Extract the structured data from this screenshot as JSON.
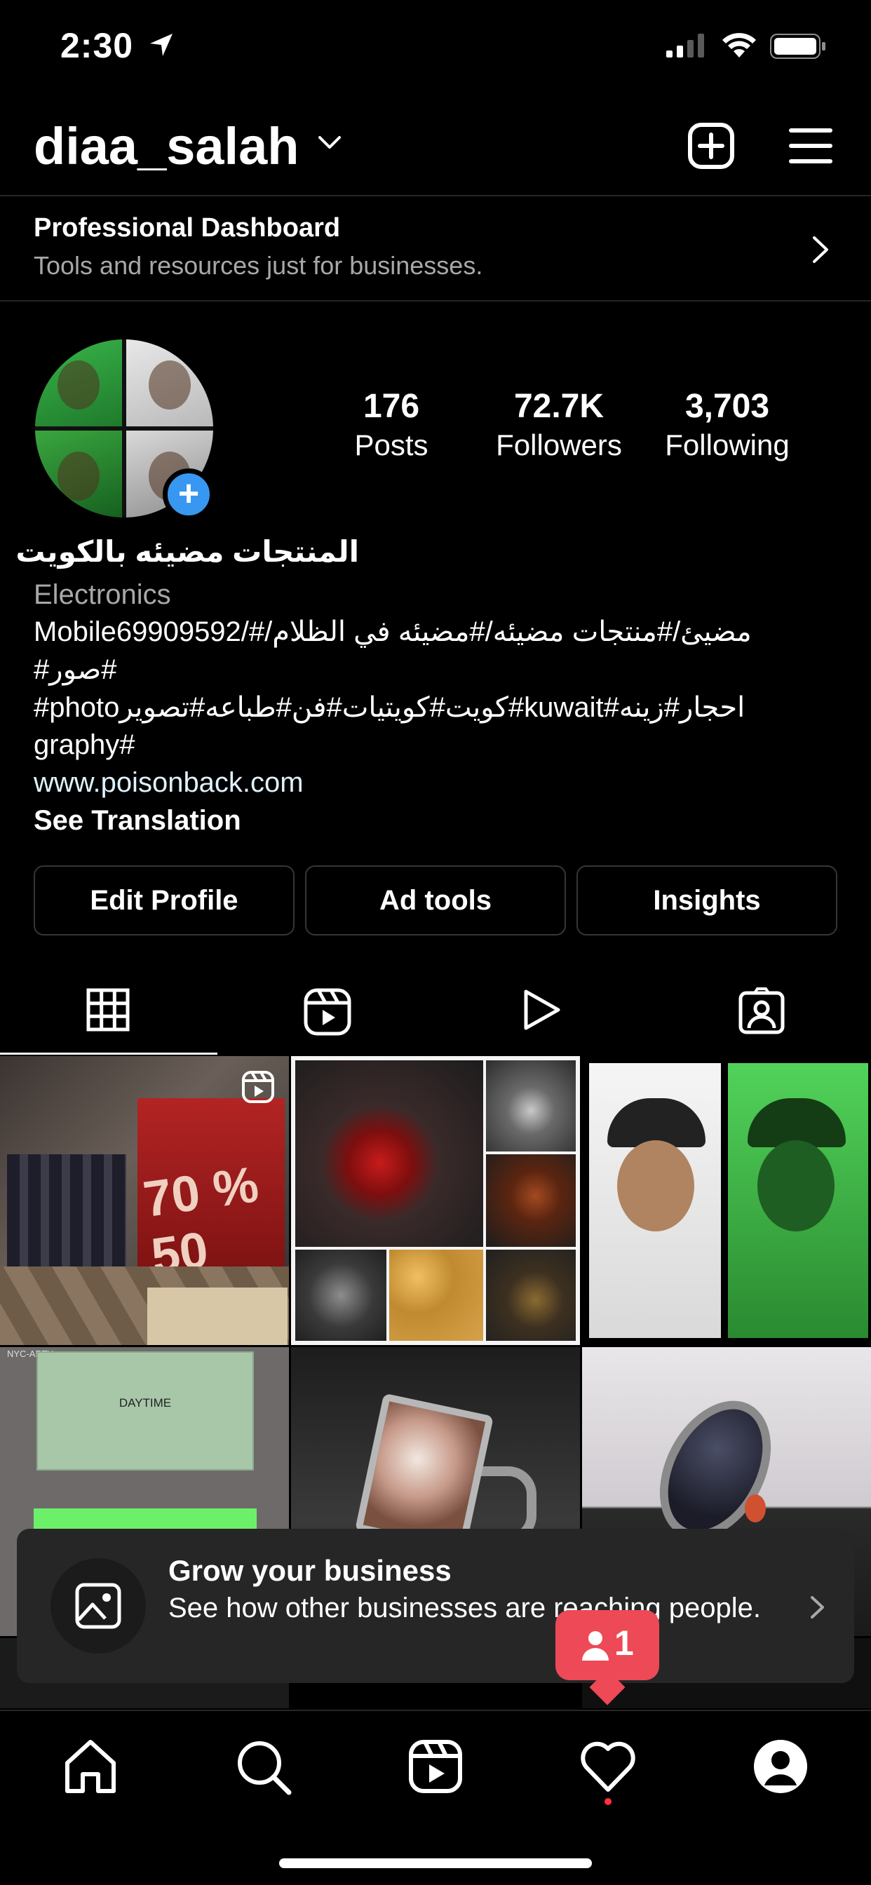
{
  "status_bar": {
    "time": "2:30"
  },
  "header": {
    "username": "diaa_salah"
  },
  "dashboard": {
    "title": "Professional Dashboard",
    "subtitle": "Tools and resources just for businesses."
  },
  "profile": {
    "stats": [
      {
        "value": "176",
        "label": "Posts"
      },
      {
        "value": "72.7K",
        "label": "Followers"
      },
      {
        "value": "3,703",
        "label": "Following"
      }
    ],
    "name": "المنتجات مضيئه  بالكويت",
    "category": "Electronics",
    "bio_lines": [
      "Mobile69909592/#/مضيئ/#منتجات مضيئه/#مضيئه في الظلام",
      "#صور#",
      "#photoكويت#كويتيات#فن#طباعه#تصوير#kuwait#احجار#زينه",
      "graphy#"
    ],
    "website": "www.poisonback.com",
    "see_translation": "See Translation"
  },
  "actions": {
    "edit_profile": "Edit Profile",
    "ad_tools": "Ad tools",
    "insights": "Insights"
  },
  "tabs": [
    "grid-icon",
    "reels-icon",
    "video-icon",
    "tagged-icon"
  ],
  "posts": {
    "p1_sign": "70 % 50",
    "p4_label": "DAYTIME",
    "p4_tag": "NYC-ARTY"
  },
  "grow_banner": {
    "title": "Grow your business",
    "description": "See how other businesses are reaching people."
  },
  "notification": {
    "count": "1"
  },
  "colors": {
    "accent_blue": "#3897f0",
    "notification_red": "#ed4956",
    "background": "#000000"
  }
}
